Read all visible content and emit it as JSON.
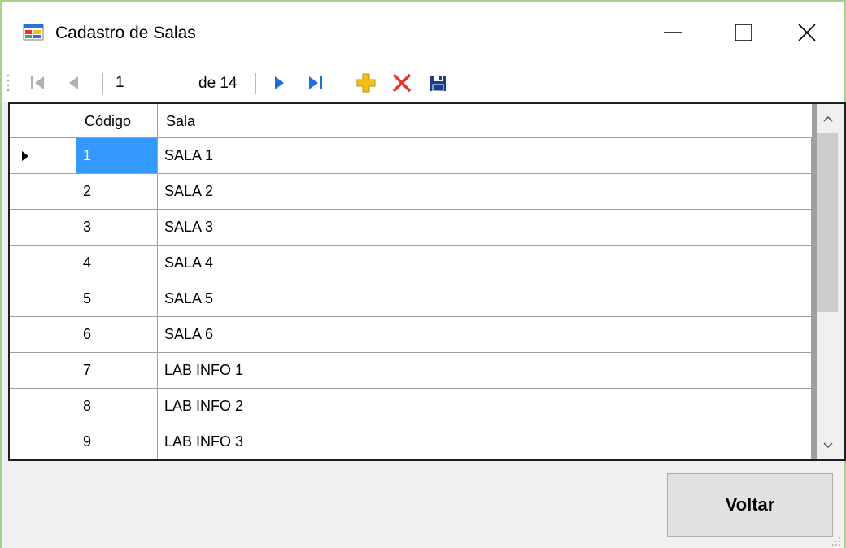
{
  "window": {
    "title": "Cadastro de Salas",
    "icons": {
      "app": "form-window-icon",
      "minimize": "minimize-icon",
      "maximize": "maximize-icon",
      "close": "close-icon"
    }
  },
  "navigator": {
    "position": "1",
    "count_label": "de 14",
    "icons": [
      "move-first-icon",
      "move-previous-icon",
      "move-next-icon",
      "move-last-icon",
      "add-new-icon",
      "delete-icon",
      "save-icon"
    ],
    "colors": {
      "nav_blue": "#1e6fd9",
      "add_yellow": "#f2c21b",
      "delete_red": "#e8322b",
      "save_blue": "#1b3f8f"
    }
  },
  "grid": {
    "columns": [
      "Código",
      "Sala"
    ],
    "rows": [
      {
        "code": "1",
        "sala": "SALA 1"
      },
      {
        "code": "2",
        "sala": "SALA 2"
      },
      {
        "code": "3",
        "sala": "SALA 3"
      },
      {
        "code": "4",
        "sala": "SALA 4"
      },
      {
        "code": "5",
        "sala": "SALA 5"
      },
      {
        "code": "6",
        "sala": "SALA 6"
      },
      {
        "code": "7",
        "sala": "LAB INFO 1"
      },
      {
        "code": "8",
        "sala": "LAB INFO 2"
      },
      {
        "code": "9",
        "sala": "LAB INFO 3"
      }
    ],
    "selection_color": "#3399ff"
  },
  "actions": {
    "back_label": "Voltar"
  }
}
